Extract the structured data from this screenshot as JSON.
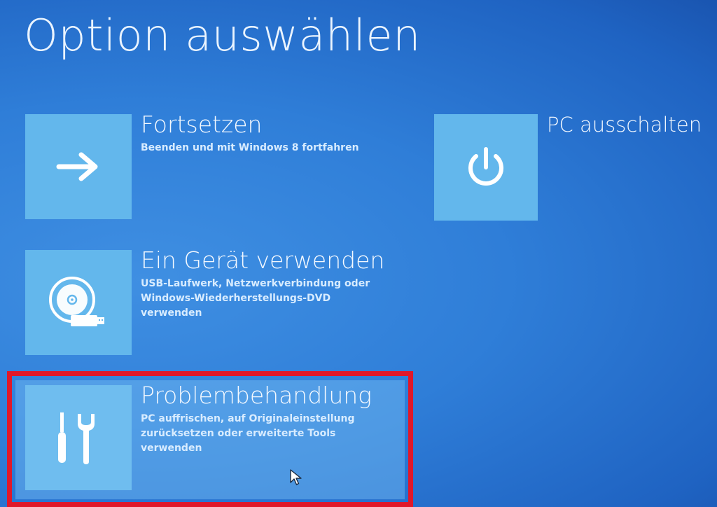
{
  "page": {
    "title": "Option auswählen"
  },
  "options": [
    {
      "title": "Fortsetzen",
      "description": "Beenden und mit Windows 8 fortfahren",
      "icon": "arrow-right-icon"
    },
    {
      "title": "Ein Gerät verwenden",
      "description": "USB-Laufwerk, Netzwerkverbindung oder Windows-Wiederherstellungs-DVD verwenden",
      "icon": "disc-usb-icon"
    },
    {
      "title": "Problembehandlung",
      "description": "PC auffrischen, auf Originaleinstellung zurücksetzen oder erweiterte Tools verwenden",
      "icon": "tools-icon",
      "highlighted": true
    },
    {
      "title": "PC ausschalten",
      "description": "",
      "icon": "power-icon"
    }
  ],
  "colors": {
    "background": "#2f7ed8",
    "tile": "#63b7ec",
    "highlight_frame": "#e0182a"
  }
}
